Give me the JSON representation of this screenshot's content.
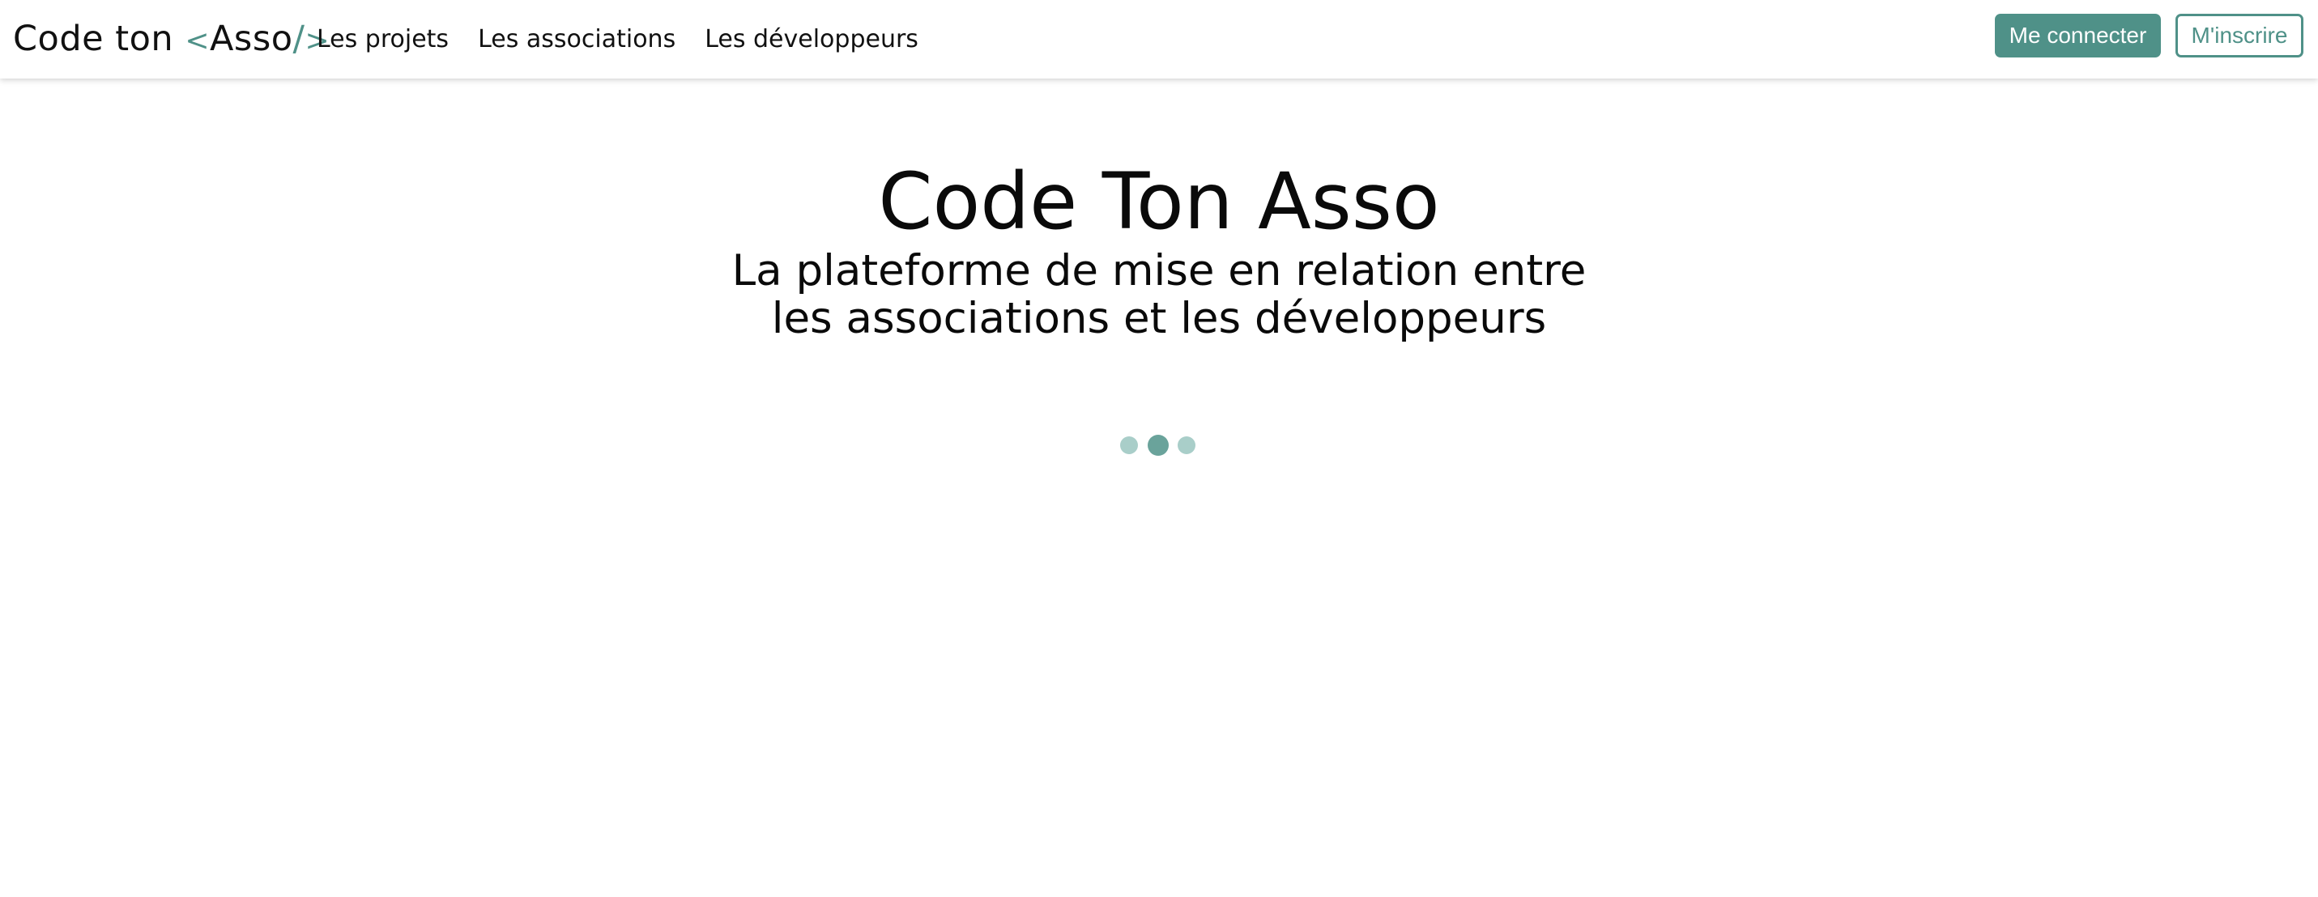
{
  "brand": {
    "part1": "Code ton ",
    "bracket_open": "<",
    "part2": "Asso",
    "slash": "/",
    "bracket_close": ">",
    "accent_color": "#4f9188"
  },
  "nav": {
    "items": [
      {
        "label": "Les projets"
      },
      {
        "label": "Les associations"
      },
      {
        "label": "Les développeurs"
      }
    ]
  },
  "auth": {
    "login_label": "Me connecter",
    "signup_label": "M'inscrire"
  },
  "hero": {
    "title": "Code Ton Asso",
    "subtitle": "La plateforme de mise en relation entre les associations et les développeurs"
  },
  "loader": {
    "dots": 3,
    "active_dot": 2,
    "active_color": "#6aa39b",
    "inactive_color": "#a9cec9"
  }
}
